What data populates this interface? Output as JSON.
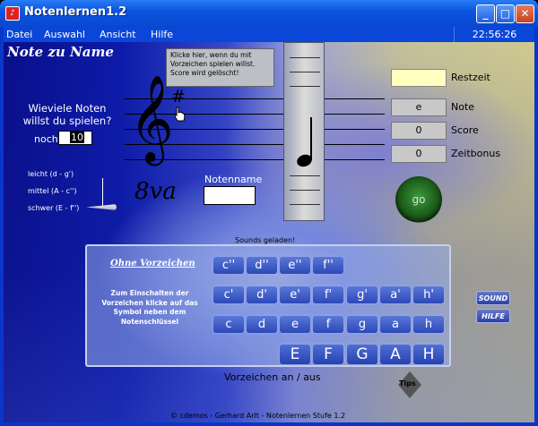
{
  "window": {
    "title": "Notenlernen1.2",
    "app_icon": "note-app-icon",
    "clock": "22:56:26",
    "buttons": {
      "minimize": "_",
      "maximize": "□",
      "close": "✕"
    }
  },
  "menu": [
    "Datei",
    "Auswahl",
    "Ansicht",
    "Hilfe"
  ],
  "mode_title": "Note zu Name",
  "tooltip": "Klicke hier, wenn du mit Vorzeichen spielen willst. Score wird gelöscht!",
  "staff": {
    "clef_glyph": "𝄞",
    "sharp_symbol": "#",
    "octave_mark": "8va"
  },
  "settings": {
    "how_many_label": "Wieviele Noten willst du spielen?",
    "noch_label": "noch",
    "count_value": "10",
    "levels": [
      "leicht (d - g')",
      "mittel (A - c'')",
      "schwer (E - f'')"
    ],
    "selected_level": "schwer (E - f'')"
  },
  "notename": {
    "label": "Notenname",
    "value": ""
  },
  "stats": {
    "restzeit": {
      "label": "Restzeit",
      "value": ""
    },
    "note": {
      "label": "Note",
      "value": "e"
    },
    "score": {
      "label": "Score",
      "value": "0"
    },
    "zeitbonus": {
      "label": "Zeitbonus",
      "value": "0"
    }
  },
  "go_button": "go",
  "sounds_loaded": "Sounds geladen!",
  "panel": {
    "ohne_label": "Ohne Vorzeichen",
    "hint": "Zum Einschalten der Vorzeichen klicke auf das Symbol neben dem Notenschlüssel",
    "row1": [
      "c''",
      "d''",
      "e''",
      "f''"
    ],
    "row2": [
      "c'",
      "d'",
      "e'",
      "f'",
      "g'",
      "a'",
      "h'"
    ],
    "row3": [
      "c",
      "d",
      "e",
      "f",
      "g",
      "a",
      "h"
    ],
    "row4": [
      "E",
      "F",
      "G",
      "A",
      "H"
    ]
  },
  "toggle_label": "Vorzeichen an / aus",
  "sound_button": "SOUND",
  "help_button": "HILFE",
  "tips_label": "Tips",
  "credits": "© cdemos - Gerhard Arlt - Notenlernen Stufe 1.2"
}
